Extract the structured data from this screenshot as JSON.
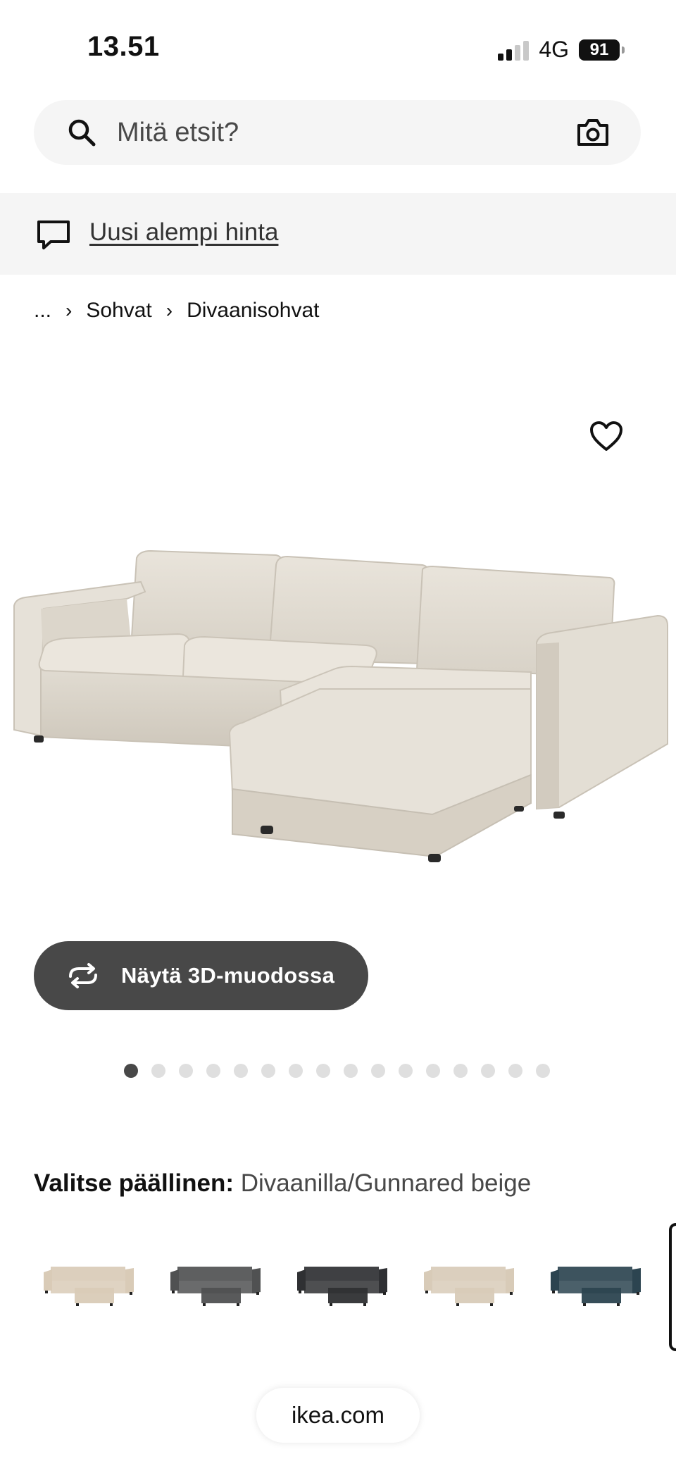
{
  "status_bar": {
    "time": "13.51",
    "network": "4G",
    "battery": "91"
  },
  "search": {
    "placeholder": "Mitä etsit?"
  },
  "notice": {
    "link_text": "Uusi alempi hinta"
  },
  "breadcrumb": [
    "...",
    "Sohvat",
    "Divaanisohvat"
  ],
  "viewer": {
    "button_3d_label": "Näytä 3D-muodossa",
    "image_count": 16,
    "active_index": 0
  },
  "cover": {
    "label": "Valitse päällinen:",
    "value": "Divaanilla/Gunnared beige",
    "swatch_colors": [
      "#d9cbb7",
      "#505152",
      "#2f3033",
      "#d8cbb8",
      "#2c4450"
    ]
  },
  "url": "ikea.com"
}
